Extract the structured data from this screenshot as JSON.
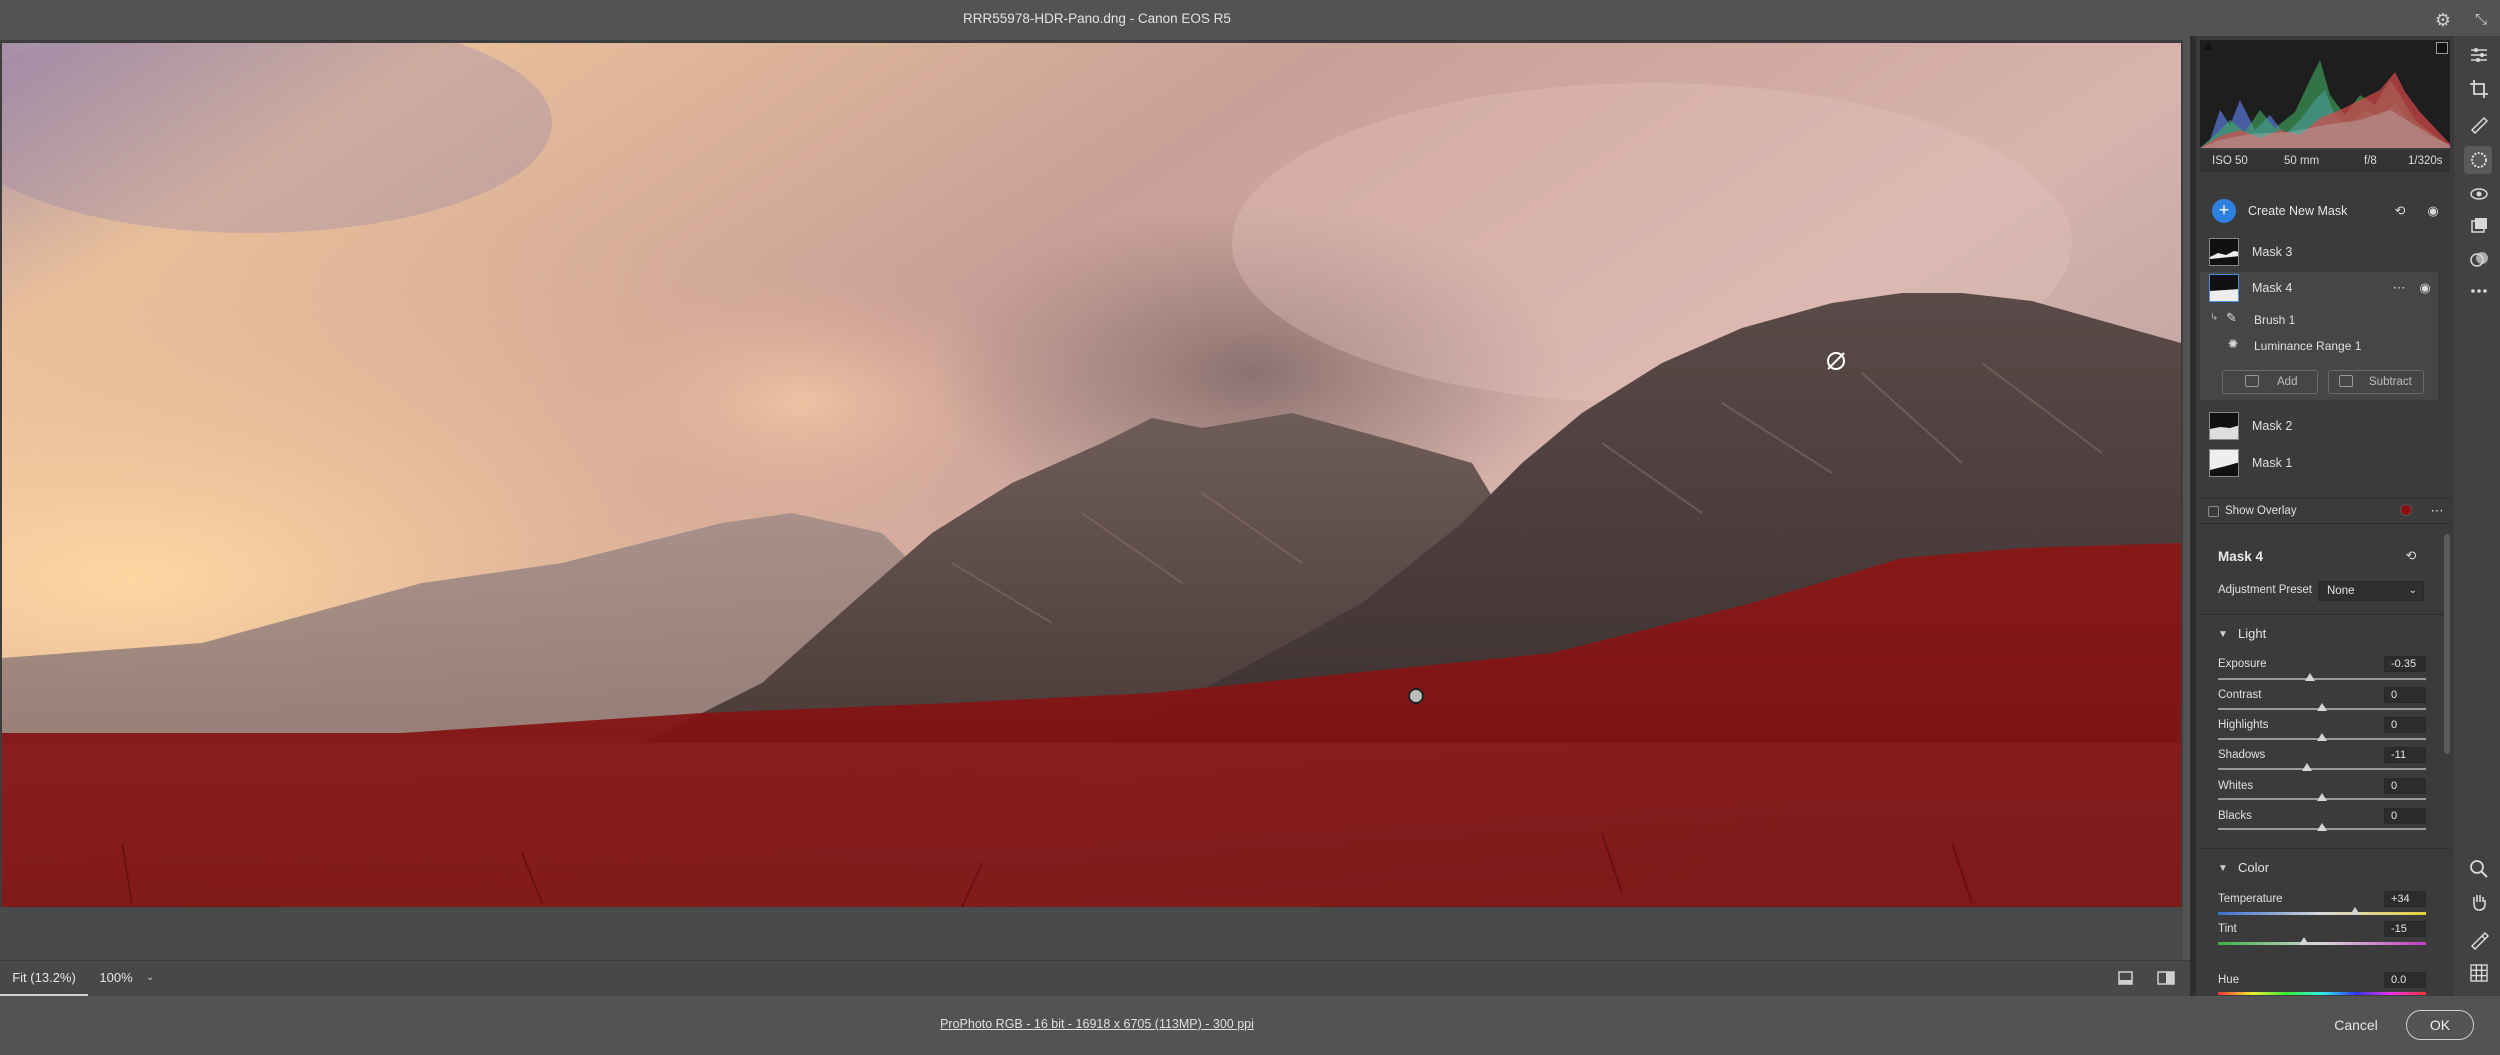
{
  "window": {
    "title": "RRR55978-HDR-Pano.dng  -  Canon EOS R5"
  },
  "view": {
    "fit_label": "Fit (13.2%)",
    "zoom_label": "100%"
  },
  "footer": {
    "workflow": "ProPhoto RGB - 16 bit - 16918 x 6705 (113MP) - 300 ppi",
    "cancel": "Cancel",
    "ok": "OK"
  },
  "camera": {
    "iso": "ISO 50",
    "focal": "50 mm",
    "aperture": "f/8",
    "shutter": "1/320s"
  },
  "masks": {
    "create_label": "Create New Mask",
    "items": [
      {
        "name": "Mask 3"
      },
      {
        "name": "Mask 4"
      },
      {
        "name": "Mask 2"
      },
      {
        "name": "Mask 1"
      }
    ],
    "components": [
      {
        "name": "Brush 1"
      },
      {
        "name": "Luminance Range 1"
      }
    ],
    "add_label": "Add",
    "subtract_label": "Subtract",
    "show_overlay": "Show Overlay",
    "overlay_color": "#8a0e0e"
  },
  "adjust": {
    "title": "Mask 4",
    "preset_label": "Adjustment Preset",
    "preset_value": "None",
    "light": {
      "title": "Light",
      "sliders": [
        {
          "label": "Exposure",
          "value": "-0.35"
        },
        {
          "label": "Contrast",
          "value": "0"
        },
        {
          "label": "Highlights",
          "value": "0"
        },
        {
          "label": "Shadows",
          "value": "-11"
        },
        {
          "label": "Whites",
          "value": "0"
        },
        {
          "label": "Blacks",
          "value": "0"
        }
      ]
    },
    "color": {
      "title": "Color",
      "sliders": [
        {
          "label": "Temperature",
          "value": "+34"
        },
        {
          "label": "Tint",
          "value": "-15"
        },
        {
          "label": "Hue",
          "value": "0.0"
        }
      ]
    }
  },
  "icons": [
    "gear-icon",
    "collapse-icon",
    "edit-icon",
    "crop-icon",
    "heal-icon",
    "masking-icon",
    "redeye-icon",
    "presets-icon",
    "snapshot-icon",
    "more-icon",
    "zoom-icon",
    "hand-icon",
    "sampler-icon",
    "grid-icon"
  ]
}
